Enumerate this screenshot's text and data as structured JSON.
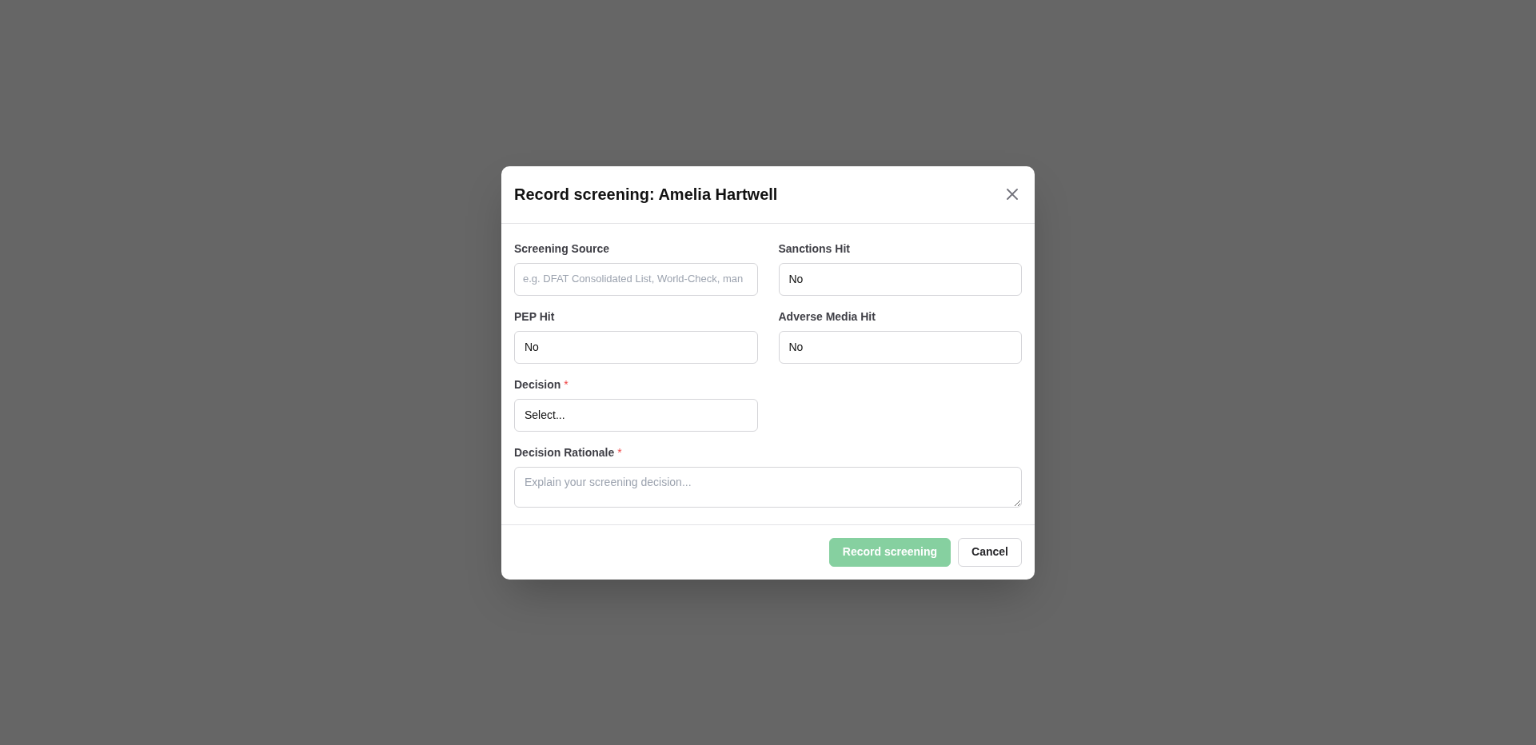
{
  "dialog": {
    "title": "Record screening: Amelia Hartwell",
    "fields": [
      {
        "kind": "text",
        "label": "Screening Source",
        "required": false,
        "placeholder": "e.g. DFAT Consolidated List, World-Check, man"
      },
      {
        "kind": "select",
        "label": "Sanctions Hit",
        "required": false,
        "value": "No"
      },
      {
        "kind": "select",
        "label": "PEP Hit",
        "required": false,
        "value": "No"
      },
      {
        "kind": "select",
        "label": "Adverse Media Hit",
        "required": false,
        "value": "No"
      },
      {
        "kind": "select",
        "label": "Decision",
        "required": true,
        "value": "Select..."
      },
      {
        "kind": "textarea",
        "label": "Decision Rationale",
        "required": true,
        "placeholder": "Explain your screening decision..."
      }
    ],
    "required_mark": "*",
    "buttons": [
      {
        "kind": "primary",
        "label": "Record screening",
        "disabled": true
      },
      {
        "kind": "secondary",
        "label": "Cancel",
        "disabled": false
      }
    ]
  }
}
